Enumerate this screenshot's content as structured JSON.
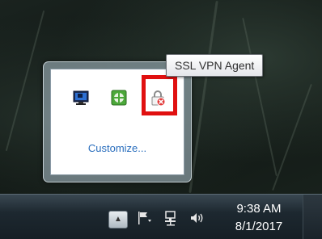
{
  "tooltip": {
    "text": "SSL VPN Agent"
  },
  "flyout": {
    "icons": [
      {
        "name": "monitor-icon"
      },
      {
        "name": "green-shield-icon"
      },
      {
        "name": "ssl-vpn-agent-icon",
        "status": "disconnected"
      }
    ],
    "customize_label": "Customize..."
  },
  "taskbar": {
    "show_hidden_icons_glyph": "▲",
    "system_icons": [
      "action-center-flag-icon",
      "network-icon",
      "volume-icon"
    ],
    "clock": {
      "time": "9:38 AM",
      "date": "8/1/2017"
    }
  },
  "colors": {
    "highlight": "#e01010",
    "link": "#2a6ebd",
    "taskbar": "#1d2830"
  }
}
